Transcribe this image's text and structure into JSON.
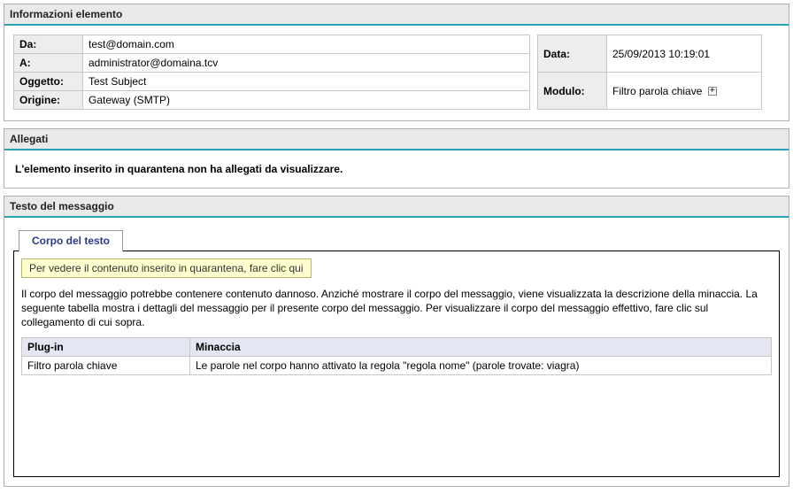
{
  "panels": {
    "itemInfo": {
      "title": "Informazioni elemento"
    },
    "attachments": {
      "title": "Allegati"
    },
    "messageText": {
      "title": "Testo del messaggio"
    }
  },
  "itemInfo": {
    "from": {
      "label": "Da:",
      "value": "test@domain.com"
    },
    "to": {
      "label": "A:",
      "value": "administrator@domaina.tcv"
    },
    "subject": {
      "label": "Oggetto:",
      "value": "Test Subject"
    },
    "origin": {
      "label": "Origine:",
      "value": "Gateway (SMTP)"
    },
    "date": {
      "label": "Data:",
      "value": "25/09/2013 10:19:01"
    },
    "module": {
      "label": "Modulo:",
      "value": "Filtro parola chiave",
      "expandGlyph": "+"
    }
  },
  "attachments": {
    "emptyText": "L'elemento inserito in quarantena non ha allegati da visualizzare."
  },
  "messageBody": {
    "tabLabel": "Corpo del testo",
    "warningLink": "Per vedere il contenuto inserito in quarantena, fare clic qui",
    "description": "Il corpo del messaggio potrebbe contenere contenuto dannoso. Anziché mostrare il corpo del messaggio, viene visualizzata la descrizione della minaccia. La seguente tabella mostra i dettagli del messaggio per il presente corpo del messaggio. Per visualizzare il corpo del messaggio effettivo, fare clic sul collegamento di cui sopra.",
    "threatTable": {
      "headers": {
        "plugin": "Plug-in",
        "threat": "Minaccia"
      },
      "row": {
        "plugin": "Filtro parola chiave",
        "threat": "Le parole nel corpo hanno attivato la regola \"regola nome\" (parole trovate: viagra)"
      }
    }
  }
}
